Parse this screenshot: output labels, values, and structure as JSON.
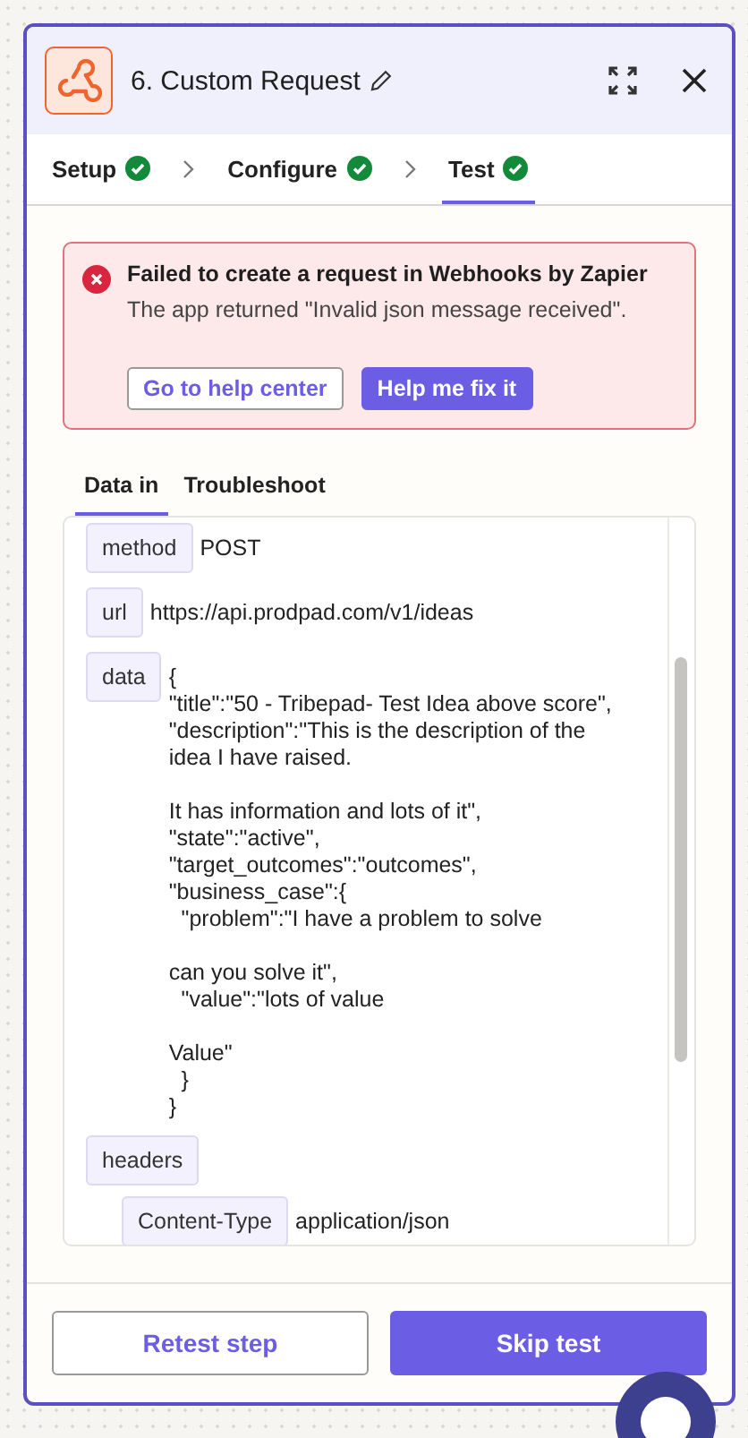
{
  "header": {
    "title": "6. Custom Request"
  },
  "steps": [
    {
      "label": "Setup",
      "complete": true,
      "selected": false
    },
    {
      "label": "Configure",
      "complete": true,
      "selected": false
    },
    {
      "label": "Test",
      "complete": true,
      "selected": true
    }
  ],
  "alert": {
    "title": "Failed to create a request in Webhooks by Zapier",
    "message": "The app returned \"Invalid json message received\".",
    "buttons": [
      {
        "label": "Go to help center",
        "kind": "secondary"
      },
      {
        "label": "Help me fix it",
        "kind": "primary"
      }
    ]
  },
  "data_tabs": [
    {
      "label": "Data in",
      "selected": true
    },
    {
      "label": "Troubleshoot",
      "selected": false
    }
  ],
  "fields": [
    {
      "key": "method",
      "value": "POST"
    },
    {
      "key": "url",
      "value": "https://api.prodpad.com/v1/ideas"
    },
    {
      "key": "data",
      "value": "{\n\"title\":\"50 - Tribepad- Test Idea above score\",\n\"description\":\"This is the description of the\nidea I have raised.\n\nIt has information and lots of it\",\n\"state\":\"active\",\n\"target_outcomes\":\"outcomes\",\n\"business_case\":{\n  \"problem\":\"I have a problem to solve\n\ncan you solve it\",\n  \"value\":\"lots of value\n\nValue\"\n  }\n}"
    },
    {
      "key": "headers",
      "children": [
        {
          "key": "Content-Type",
          "value": "application/json"
        }
      ]
    }
  ],
  "footer": {
    "buttons": [
      {
        "label": "Retest step",
        "kind": "secondary"
      },
      {
        "label": "Skip test",
        "kind": "primary"
      }
    ]
  }
}
